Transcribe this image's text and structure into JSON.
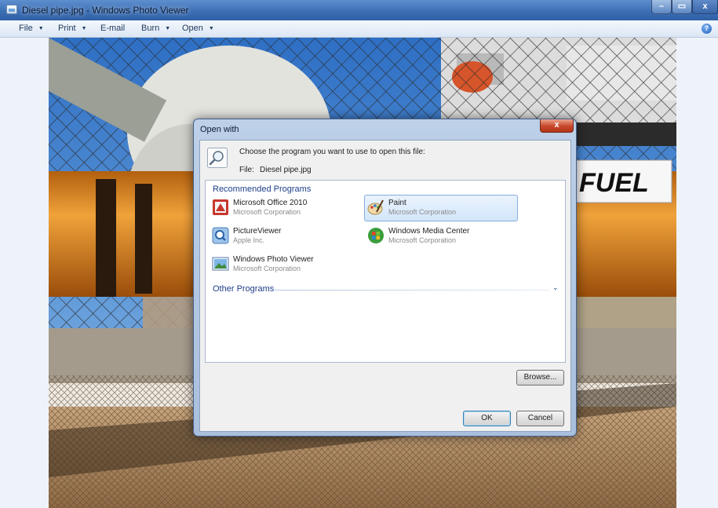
{
  "window": {
    "title": "Diesel pipe.jpg - Windows Photo Viewer",
    "min_glyph": "–",
    "max_glyph": "▭",
    "close_glyph": "x"
  },
  "menu": {
    "file": "File",
    "print": "Print",
    "email": "E-mail",
    "burn": "Burn",
    "open": "Open",
    "dropdown_glyph": "▼",
    "help_glyph": "?"
  },
  "photo": {
    "sign_text": "FUEL"
  },
  "dialog": {
    "title": "Open with",
    "close_glyph": "x",
    "prompt": "Choose the program you want to use to open this file:",
    "file_label": "File:",
    "file_name": "Diesel pipe.jpg",
    "recommended_heading": "Recommended Programs",
    "other_heading": "Other Programs",
    "other_chevron": "⌄",
    "programs": [
      {
        "name": "Microsoft Office 2010",
        "publisher": "Microsoft Corporation",
        "icon": "office-icon"
      },
      {
        "name": "Paint",
        "publisher": "Microsoft Corporation",
        "icon": "paint-icon",
        "selected": true
      },
      {
        "name": "PictureViewer",
        "publisher": "Apple Inc.",
        "icon": "pictureviewer-icon"
      },
      {
        "name": "Windows Media Center",
        "publisher": "Microsoft Corporation",
        "icon": "media-center-icon"
      },
      {
        "name": "Windows Photo Viewer",
        "publisher": "Microsoft Corporation",
        "icon": "photo-viewer-icon"
      }
    ],
    "browse_label": "Browse...",
    "ok_label": "OK",
    "cancel_label": "Cancel"
  },
  "colors": {
    "titlebar": "#3d6fb5",
    "selection": "#d3e6fb",
    "section_heading": "#1e3f8a",
    "pipe_orange": "#d9831d"
  }
}
